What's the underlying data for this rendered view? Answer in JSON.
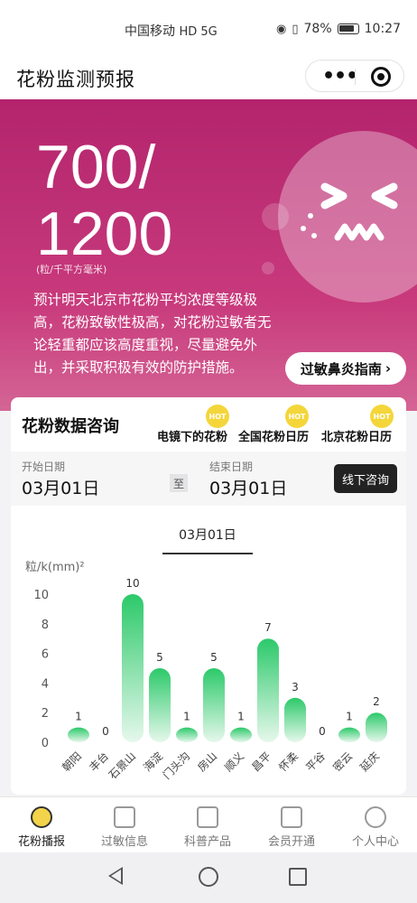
{
  "status_bar": {
    "carrier": "中国移动",
    "network": "HD 5G",
    "battery": "78%",
    "time": "10:27"
  },
  "app_bar": {
    "title": "花粉监测预报",
    "more_icon": "more-dots-icon",
    "close_icon": "target-icon"
  },
  "hero": {
    "value_line1": "700/",
    "value_line2": "1200",
    "unit": "(粒/千平方毫米)",
    "description": "预计明天北京市花粉平均浓度等级极高，花粉致敏性极高，对花粉过敏者无论轻重都应该高度重视，尽量避免外出，并采取积极有效的防护措施。",
    "guide_button": "过敏鼻炎指南",
    "guide_arrow": "›",
    "face_icon": "annoyed-face-icon"
  },
  "data_card": {
    "title": "花粉数据咨询",
    "links": [
      {
        "label": "电镜下的花粉",
        "badge": "HOT"
      },
      {
        "label": "全国花粉日历",
        "badge": "HOT"
      },
      {
        "label": "北京花粉日历",
        "badge": "HOT"
      }
    ],
    "start_label": "开始日期",
    "start_value": "03月01日",
    "to_label": "至",
    "end_label": "结束日期",
    "end_value": "03月01日",
    "consult_button": "线下咨询",
    "chart_tab": "03月01日"
  },
  "chart_data": {
    "type": "bar",
    "ylabel": "粒/k(mm)²",
    "ylim": [
      0,
      10
    ],
    "yticks": [
      0,
      2,
      4,
      6,
      8,
      10
    ],
    "categories": [
      "朝阳",
      "丰台",
      "石景山",
      "海淀",
      "门头沟",
      "房山",
      "顺义",
      "昌平",
      "怀柔",
      "平谷",
      "密云",
      "延庆"
    ],
    "values": [
      1,
      0,
      10,
      5,
      1,
      5,
      1,
      7,
      3,
      0,
      1,
      2
    ],
    "bar_color_top": "#2cc96a",
    "bar_color_bottom": "#e6f8ec"
  },
  "tab_bar": {
    "items": [
      {
        "label": "花粉播报",
        "icon": "flower-icon",
        "active": true
      },
      {
        "label": "过敏信息",
        "icon": "document-icon",
        "active": false
      },
      {
        "label": "科普产品",
        "icon": "book-icon",
        "active": false
      },
      {
        "label": "会员开通",
        "icon": "crown-icon",
        "active": false
      },
      {
        "label": "个人中心",
        "icon": "user-icon",
        "active": false
      }
    ]
  },
  "nav_bar": {
    "back_icon": "back-triangle-icon",
    "home_icon": "home-circle-icon",
    "recent_icon": "recent-square-icon"
  }
}
